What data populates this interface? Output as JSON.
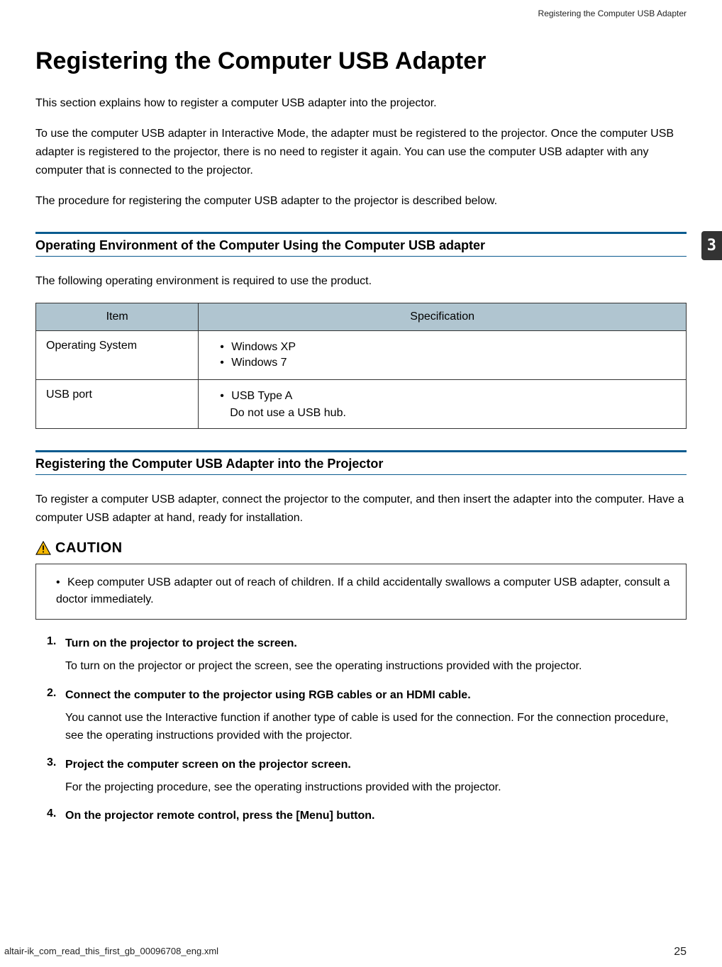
{
  "header": {
    "running": "Registering the Computer USB Adapter"
  },
  "tab": {
    "number": "3"
  },
  "title": "Registering the Computer USB Adapter",
  "intro": {
    "p1": "This section explains how to register a computer USB adapter into the projector.",
    "p2": "To use the computer USB adapter in Interactive Mode, the adapter must be registered to the projector. Once the computer USB adapter is registered to the projector, there is no need to register it again. You can use the computer USB adapter with any computer that is connected to the projector.",
    "p3": "The procedure for registering the computer USB adapter to the projector is described below."
  },
  "section1": {
    "heading": "Operating Environment of the Computer Using the Computer USB adapter",
    "lead": "The following operating environment is required to use the product.",
    "table": {
      "headers": {
        "col1": "Item",
        "col2": "Specification"
      },
      "rows": [
        {
          "item": "Operating System",
          "specs": [
            "Windows XP",
            "Windows 7"
          ],
          "note": ""
        },
        {
          "item": "USB port",
          "specs": [
            "USB Type A"
          ],
          "note": "Do not use a USB hub."
        }
      ]
    }
  },
  "section2": {
    "heading": "Registering the Computer USB Adapter into the Projector",
    "lead": "To register a computer USB adapter, connect the projector to the computer, and then insert the adapter into the computer. Have a computer USB adapter at hand, ready for installation.",
    "caution": {
      "label": "CAUTION",
      "items": [
        "Keep computer USB adapter out of reach of children. If a child accidentally swallows a computer USB adapter, consult a doctor immediately."
      ]
    },
    "steps": [
      {
        "title": "Turn on the projector to project the screen.",
        "body": "To turn on the projector or project the screen, see the operating instructions provided with the projector."
      },
      {
        "title": "Connect the computer to the projector using RGB cables or an HDMI cable.",
        "body": "You cannot use the Interactive function if another type of cable is used for the connection. For the connection procedure, see the operating instructions provided with the projector."
      },
      {
        "title": "Project the computer screen on the projector screen.",
        "body": "For the projecting procedure, see the operating instructions provided with the projector."
      },
      {
        "title": "On the projector remote control, press the [Menu] button.",
        "body": ""
      }
    ]
  },
  "footer": {
    "filename": "altair-ik_com_read_this_first_gb_00096708_eng.xml",
    "page": "25"
  }
}
